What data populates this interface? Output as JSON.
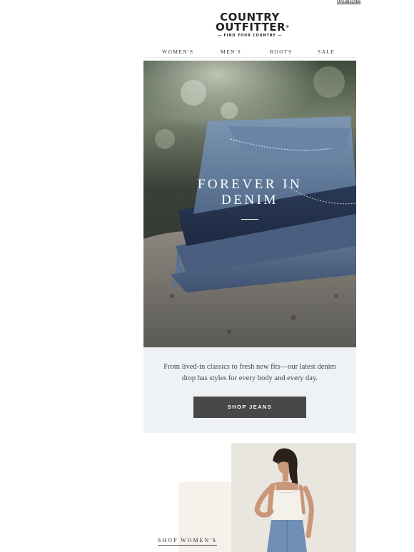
{
  "header": {
    "unsubscribe_label": "Unsubscribe",
    "logo_line1": "COUNTRY",
    "logo_line2": "OUTFITTER",
    "logo_reg": "®",
    "logo_tagline": "FIND YOUR COUNTRY"
  },
  "nav": {
    "items": [
      {
        "label": "WOMEN'S"
      },
      {
        "label": "MEN'S"
      },
      {
        "label": "BOOTS"
      },
      {
        "label": "SALE"
      }
    ]
  },
  "hero": {
    "title_line1": "FOREVER IN",
    "title_line2": "DENIM"
  },
  "promo": {
    "text": "From lived-in classics to fresh new fits—our latest denim drop has styles for every body and every day.",
    "button_label": "SHOP JEANS"
  },
  "feature": {
    "shop_link_label": "SHOP WOMEN'S"
  },
  "colors": {
    "promo_bg": "#eef2f4",
    "button_bg": "#4a4748",
    "beige_block": "#f6f1ea"
  }
}
